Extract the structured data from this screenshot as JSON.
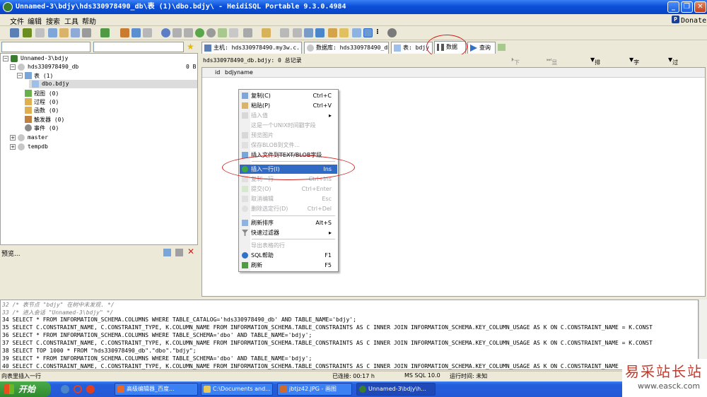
{
  "window": {
    "title": "Unnamed-3\\bdjy\\hds330978490_db\\表 (1)\\dbo.bdjy\\ - HeidiSQL Portable 9.3.0.4984"
  },
  "menu": [
    "文件",
    "编辑",
    "搜索",
    "工具",
    "帮助"
  ],
  "donate": "Donate",
  "tree": {
    "session": "Unnamed-3\\bdjy",
    "db": "hds330978490_db",
    "db_size": "0 B",
    "tables": "表 (1)",
    "table": "dbo.bdjy",
    "views": "视图 (0)",
    "procs": "过程 (0)",
    "funcs": "函数 (0)",
    "triggers": "触发器 (0)",
    "events": "事件 (0)",
    "master": "master",
    "tempdb": "tempdb"
  },
  "preview_label": "预览...",
  "tabs": {
    "host": "主机: hds330978490.my3w.c...",
    "database": "数据库: hds330978490_db",
    "table": "表: bdjy",
    "data": "数据",
    "query": "查询"
  },
  "data_header": {
    "summary": "hds330978490_db.bdjy: 0 总记录",
    "next": "下一个",
    "show_all": "显示所有",
    "sort": "排序",
    "columns": "字段",
    "filters": "过滤器"
  },
  "columns": [
    "id",
    "bdjyname"
  ],
  "context_menu": [
    {
      "label": "复制(C)",
      "shortcut": "Ctrl+C"
    },
    {
      "label": "粘贴(P)",
      "shortcut": "Ctrl+V"
    },
    {
      "label": "插入值",
      "shortcut": ""
    },
    {
      "label": "这是一个UNIX时间戳字段",
      "shortcut": ""
    },
    {
      "label": "预览图片",
      "shortcut": ""
    },
    {
      "label": "保存BLOB到文件...",
      "shortcut": ""
    },
    {
      "label": "插入文件到TEXT/BLOB字段",
      "shortcut": ""
    },
    {
      "label": "插入一行(I)",
      "shortcut": "Ins"
    },
    {
      "label": "复制一行",
      "shortcut": "Ctrl+Ins"
    },
    {
      "label": "提交(O)",
      "shortcut": "Ctrl+Enter"
    },
    {
      "label": "取消编辑",
      "shortcut": "Esc"
    },
    {
      "label": "删除选定行(D)",
      "shortcut": "Ctrl+Del"
    },
    {
      "label": "刷新排序",
      "shortcut": "Alt+S"
    },
    {
      "label": "快速过滤器",
      "shortcut": ""
    },
    {
      "label": "导出表格的行",
      "shortcut": ""
    },
    {
      "label": "SQL帮助",
      "shortcut": "F1"
    },
    {
      "label": "刷新",
      "shortcut": "F5"
    }
  ],
  "sql_log": {
    "l32": "32 /* 表节点 \"bdjy\" 在树中未发现. */",
    "l33": "33 /* 进入会话 \"Unnamed-3\\bdjy\" */",
    "l34": "34 SELECT * FROM INFORMATION_SCHEMA.COLUMNS WHERE TABLE_CATALOG='hds330978490_db' AND TABLE_NAME='bdjy';",
    "l35": "35 SELECT C.CONSTRAINT_NAME, C.CONSTRAINT_TYPE, K.COLUMN_NAME FROM INFORMATION_SCHEMA.TABLE_CONSTRAINTS AS C INNER JOIN INFORMATION_SCHEMA.KEY_COLUMN_USAGE AS K ON C.CONSTRAINT_NAME = K.CONST",
    "l36": "36 SELECT * FROM INFORMATION_SCHEMA.COLUMNS WHERE TABLE_SCHEMA='dbo' AND TABLE_NAME='bdjy';",
    "l37": "37 SELECT C.CONSTRAINT_NAME, C.CONSTRAINT_TYPE, K.COLUMN_NAME FROM INFORMATION_SCHEMA.TABLE_CONSTRAINTS AS C INNER JOIN INFORMATION_SCHEMA.KEY_COLUMN_USAGE AS K ON C.CONSTRAINT_NAME = K.CONST",
    "l38": "38 SELECT TOP 1000 * FROM \"hds330978490_db\".\"dbo\".\"bdjy\";",
    "l39": "39 SELECT * FROM INFORMATION_SCHEMA.COLUMNS WHERE TABLE_SCHEMA='dbo' AND TABLE_NAME='bdjy';",
    "l40": "40 SELECT C.CONSTRAINT_NAME, C.CONSTRAINT_TYPE, K.COLUMN_NAME FROM INFORMATION_SCHEMA.TABLE_CONSTRAINTS AS C INNER JOIN INFORMATION_SCHEMA.KEY_COLUMN_USAGE AS K ON C.CONSTRAINT_NAME = K.CONST"
  },
  "status": {
    "hint": "向表里插入一行",
    "connected": "已连接: 00:17 h",
    "server": "MS SQL 10.0",
    "runtime": "运行时间: 未知"
  },
  "taskbar": {
    "start": "开始",
    "t1": "高级编辑器_百度...",
    "t2": "C:\\Documents and...",
    "t3": "jbtjz42.JPG - 画图",
    "t4": "Unnamed-3\\bdjy\\h..."
  },
  "watermark": {
    "cn": "易采站长站",
    "url": "www.easck.com"
  }
}
